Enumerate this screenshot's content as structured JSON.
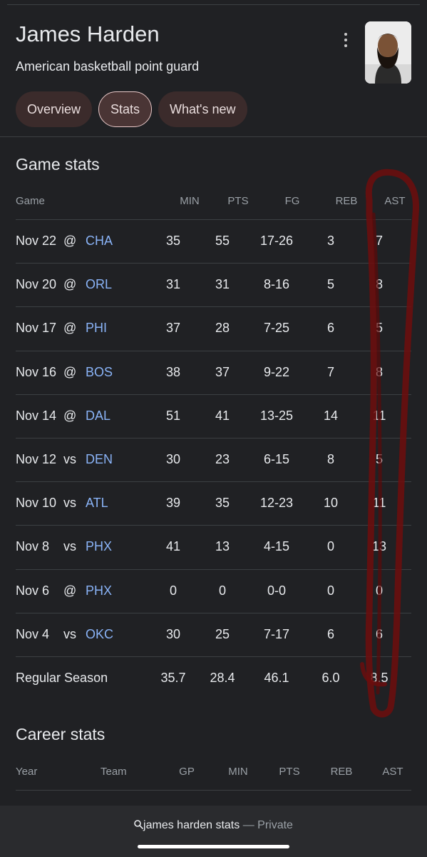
{
  "header": {
    "title": "James Harden",
    "subtitle": "American basketball point guard",
    "tabs": [
      {
        "label": "Overview",
        "active": false
      },
      {
        "label": "Stats",
        "active": true
      },
      {
        "label": "What's new",
        "active": false
      }
    ]
  },
  "game_stats": {
    "title": "Game stats",
    "columns": [
      "Game",
      "MIN",
      "PTS",
      "FG",
      "REB",
      "AST"
    ],
    "rows": [
      {
        "date": "Nov 22",
        "loc": "@",
        "opp": "CHA",
        "min": "35",
        "pts": "55",
        "fg": "17-26",
        "reb": "3",
        "ast": "7"
      },
      {
        "date": "Nov 20",
        "loc": "@",
        "opp": "ORL",
        "min": "31",
        "pts": "31",
        "fg": "8-16",
        "reb": "5",
        "ast": "8"
      },
      {
        "date": "Nov 17",
        "loc": "@",
        "opp": "PHI",
        "min": "37",
        "pts": "28",
        "fg": "7-25",
        "reb": "6",
        "ast": "5"
      },
      {
        "date": "Nov 16",
        "loc": "@",
        "opp": "BOS",
        "min": "38",
        "pts": "37",
        "fg": "9-22",
        "reb": "7",
        "ast": "8"
      },
      {
        "date": "Nov 14",
        "loc": "@",
        "opp": "DAL",
        "min": "51",
        "pts": "41",
        "fg": "13-25",
        "reb": "14",
        "ast": "11"
      },
      {
        "date": "Nov 12",
        "loc": "vs",
        "opp": "DEN",
        "min": "30",
        "pts": "23",
        "fg": "6-15",
        "reb": "8",
        "ast": "5"
      },
      {
        "date": "Nov 10",
        "loc": "vs",
        "opp": "ATL",
        "min": "39",
        "pts": "35",
        "fg": "12-23",
        "reb": "10",
        "ast": "11"
      },
      {
        "date": "Nov 8",
        "loc": "vs",
        "opp": "PHX",
        "min": "41",
        "pts": "13",
        "fg": "4-15",
        "reb": "0",
        "ast": "13"
      },
      {
        "date": "Nov 6",
        "loc": "@",
        "opp": "PHX",
        "min": "0",
        "pts": "0",
        "fg": "0-0",
        "reb": "0",
        "ast": "0"
      },
      {
        "date": "Nov 4",
        "loc": "vs",
        "opp": "OKC",
        "min": "30",
        "pts": "25",
        "fg": "7-17",
        "reb": "6",
        "ast": "6"
      }
    ],
    "season": {
      "label": "Regular Season",
      "min": "35.7",
      "pts": "28.4",
      "fg": "46.1",
      "reb": "6.0",
      "ast": "8.5"
    }
  },
  "career_stats": {
    "title": "Career stats",
    "columns": [
      "Year",
      "Team",
      "GP",
      "MIN",
      "PTS",
      "REB",
      "AST"
    ]
  },
  "footer": {
    "query": "james harden stats",
    "separator": "—",
    "mode": "Private"
  },
  "colors": {
    "background": "#202124",
    "link": "#8ab4f8",
    "tab_bg": "#3b2b2b",
    "annotation": "#7a1010"
  }
}
